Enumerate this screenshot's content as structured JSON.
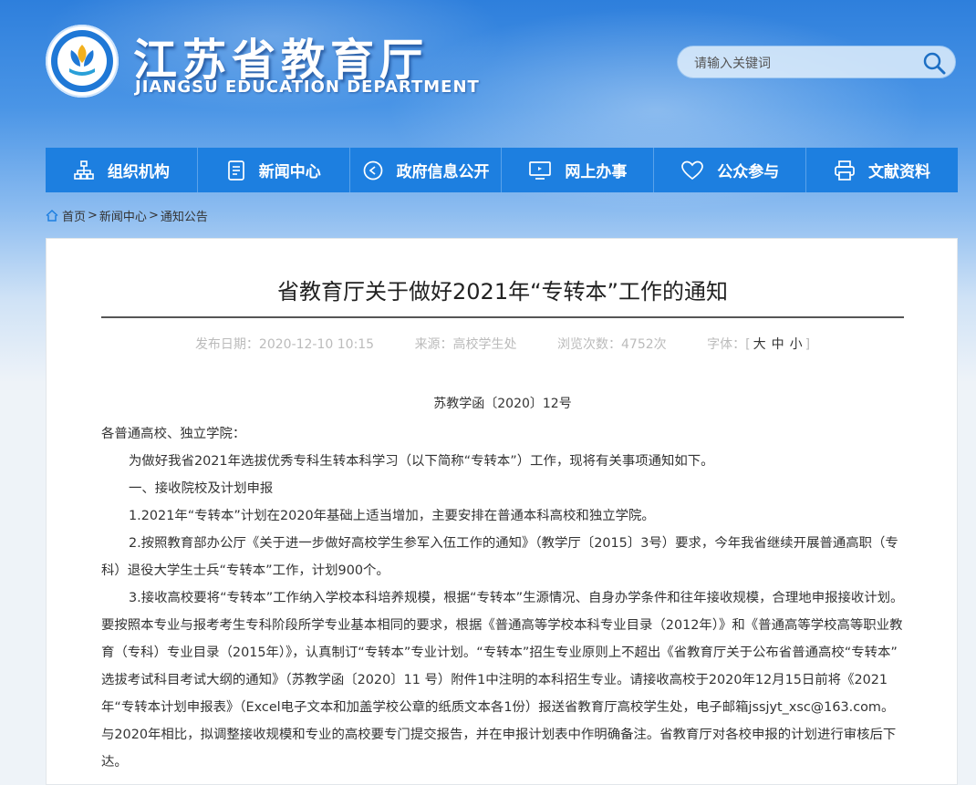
{
  "site": {
    "title_cn": "江苏省教育厅",
    "title_en": "JIANGSU EDUCATION DEPARTMENT"
  },
  "search": {
    "placeholder": "请输入关键词"
  },
  "nav": [
    {
      "label": "组织机构",
      "icon": "org-chart-icon"
    },
    {
      "label": "新闻中心",
      "icon": "document-icon"
    },
    {
      "label": "政府信息公开",
      "icon": "play-circle-icon"
    },
    {
      "label": "网上办事",
      "icon": "monitor-icon"
    },
    {
      "label": "公众参与",
      "icon": "heart-icon"
    },
    {
      "label": "文献资料",
      "icon": "printer-icon"
    }
  ],
  "breadcrumb": [
    "首页",
    "新闻中心",
    "通知公告"
  ],
  "article": {
    "title": "省教育厅关于做好2021年“专转本”工作的通知",
    "meta": {
      "date": "发布日期：2020-12-10 10:15",
      "source": "来源：高校学生处",
      "views": "浏览次数：4752次",
      "font_label": "字体：",
      "font_sizes": [
        "大",
        "中",
        "小"
      ]
    },
    "doc_no": "苏教学函〔2020〕12号",
    "paragraphs": [
      "各普通高校、独立学院：",
      "为做好我省2021年选拔优秀专科生转本科学习（以下简称“专转本”）工作，现将有关事项通知如下。",
      "一、接收院校及计划申报",
      "1.2021年“专转本”计划在2020年基础上适当增加，主要安排在普通本科高校和独立学院。",
      "2.按照教育部办公厅《关于进一步做好高校学生参军入伍工作的通知》（教学厅〔2015〕3号）要求，今年我省继续开展普通高职（专科）退役大学生士兵“专转本”工作，计划900个。",
      "3.接收高校要将“专转本”工作纳入学校本科培养规模，根据“专转本”生源情况、自身办学条件和往年接收规模，合理地申报接收计划。要按照本专业与报考考生专科阶段所学专业基本相同的要求，根据《普通高等学校本科专业目录（2012年）》和《普通高等学校高等职业教育（专科）专业目录（2015年）》，认真制订“专转本”专业计划。“专转本”招生专业原则上不超出《省教育厅关于公布省普通高校“专转本” 选拔考试科目考试大纲的通知》（苏教学函〔2020〕11 号）附件1中注明的本科招生专业。请接收高校于2020年12月15日前将《2021年“专转本计划申报表》（Excel电子文本和加盖学校公章的纸质文本各1份）报送省教育厅高校学生处，电子邮箱jssjyt_xsc@163.com。与2020年相比，拟调整接收规模和专业的高校要专门提交报告，并在申报计划表中作明确备注。省教育厅对各校申报的计划进行审核后下达。"
    ]
  }
}
